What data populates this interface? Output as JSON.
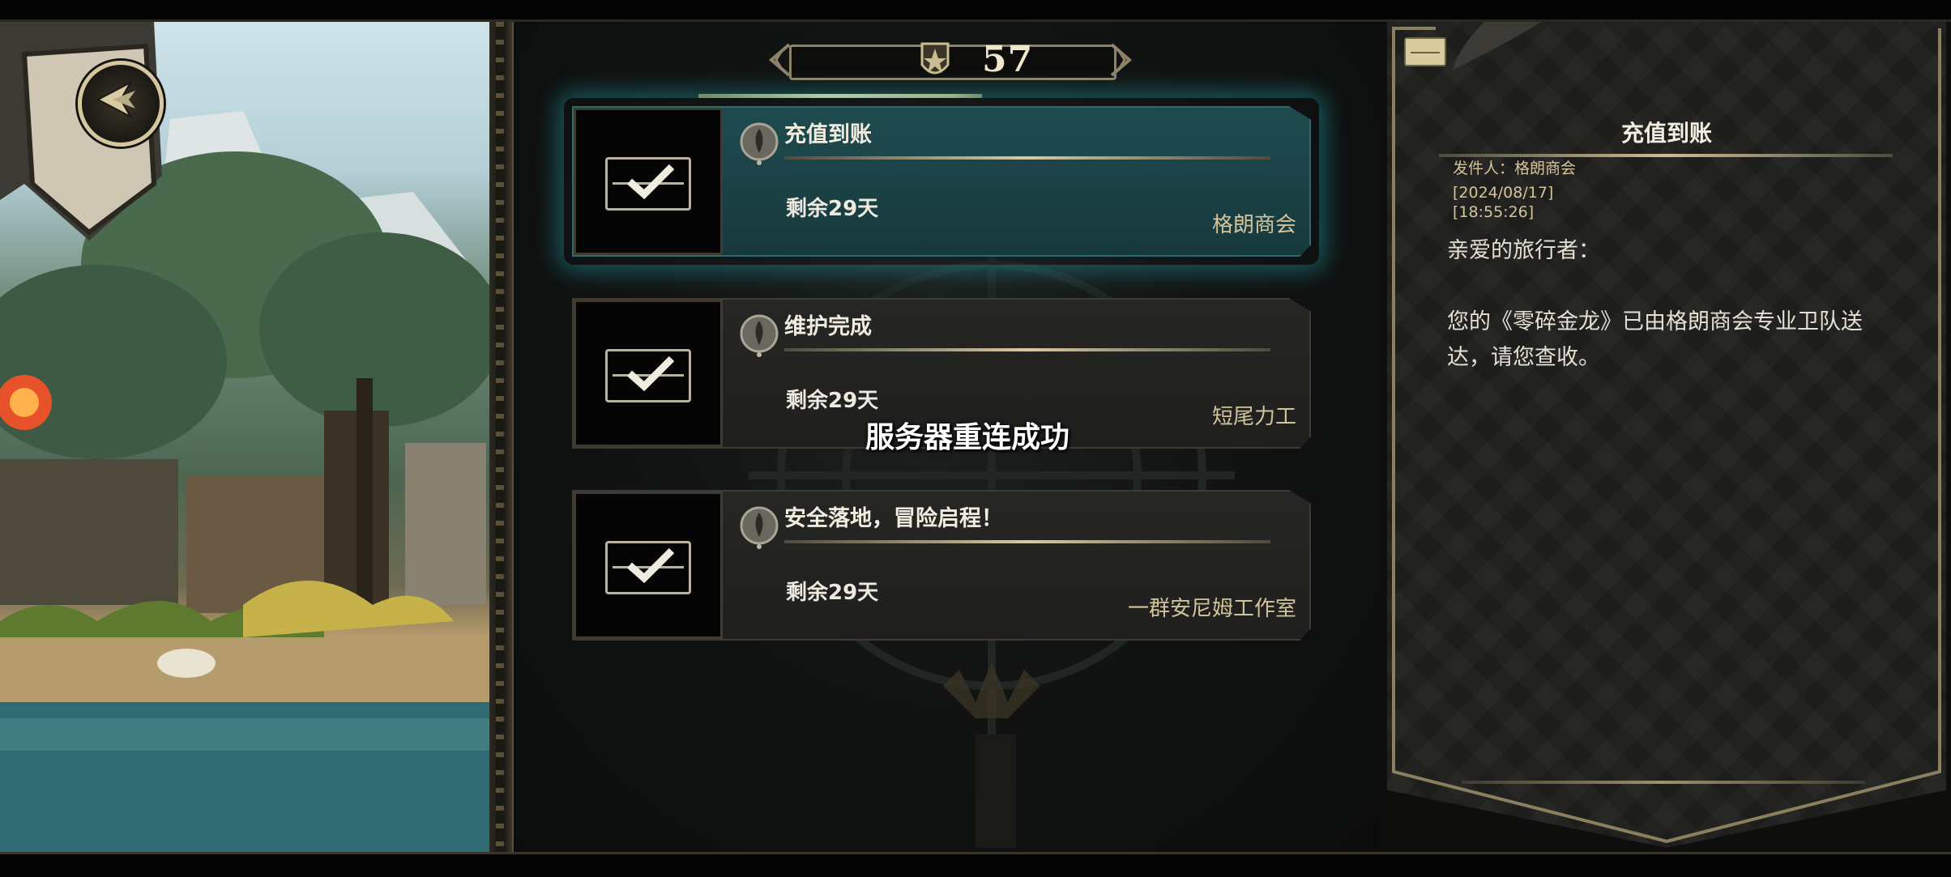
{
  "header": {
    "mail_count": "57"
  },
  "mails": [
    {
      "title": "充值到账",
      "expire": "剩余29天",
      "sender": "格朗商会",
      "selected": true
    },
    {
      "title": "维护完成",
      "expire": "剩余29天",
      "sender": "短尾力工",
      "selected": false
    },
    {
      "title": "安全落地，冒险启程！",
      "expire": "剩余29天",
      "sender": "一群安尼姆工作室",
      "selected": false
    }
  ],
  "toast": "服务器重连成功",
  "detail": {
    "title": "充值到账",
    "sender_line": "发件人：格朗商会",
    "date": "[2024/08/17]",
    "time": "[18:55:26]",
    "greeting": "亲爱的旅行者：",
    "body": "您的《零碎金龙》已由格朗商会专业卫队送达，请您查收。"
  },
  "icons": [
    "back-arrow-icon",
    "mail-count-icon",
    "envelope-check-icon",
    "wax-seal-icon",
    "envelope-icon"
  ],
  "colors": {
    "selected_card": "#1f4b4f",
    "accent_gold": "#d7cba2",
    "glow": "#28aab4"
  }
}
